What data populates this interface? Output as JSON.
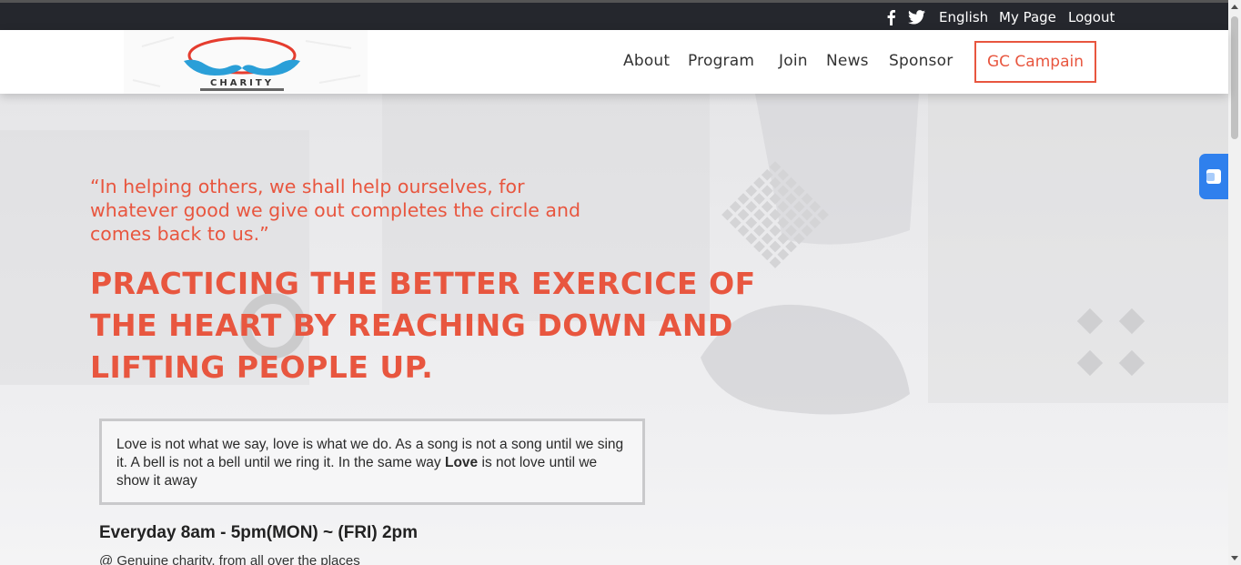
{
  "topbar": {
    "social": [
      "facebook-icon",
      "twitter-icon"
    ],
    "language": "English",
    "mypage": "My Page",
    "logout": "Logout"
  },
  "logo": {
    "text": "CHARITY"
  },
  "nav": {
    "items": [
      "About",
      "Program",
      "Join",
      "News",
      "Sponsor"
    ],
    "cta": "GC Campain"
  },
  "hero": {
    "quote": "“In helping others, we shall help ourselves, for whatever good we give out completes the circle and comes back to us.”",
    "headline": "PRACTICING THE BETTER EXERCICE OF THE HEART BY REACHING DOWN AND LIFTING PEOPLE UP.",
    "box_text_before": "Love is not what we say, love is what we do. As a song is not a song until we sing it. A bell is not a bell until we ring it. In the same way ",
    "box_text_bold": "Love",
    "box_text_after": " is not love until we show it away",
    "hours": "Everyday 8am - 5pm(MON) ~ (FRI) 2pm",
    "subtext": "@ Genuine charity, from all over the places"
  },
  "colors": {
    "accent": "#e8563f",
    "topbar": "#25272d",
    "widget": "#2f80ed"
  }
}
